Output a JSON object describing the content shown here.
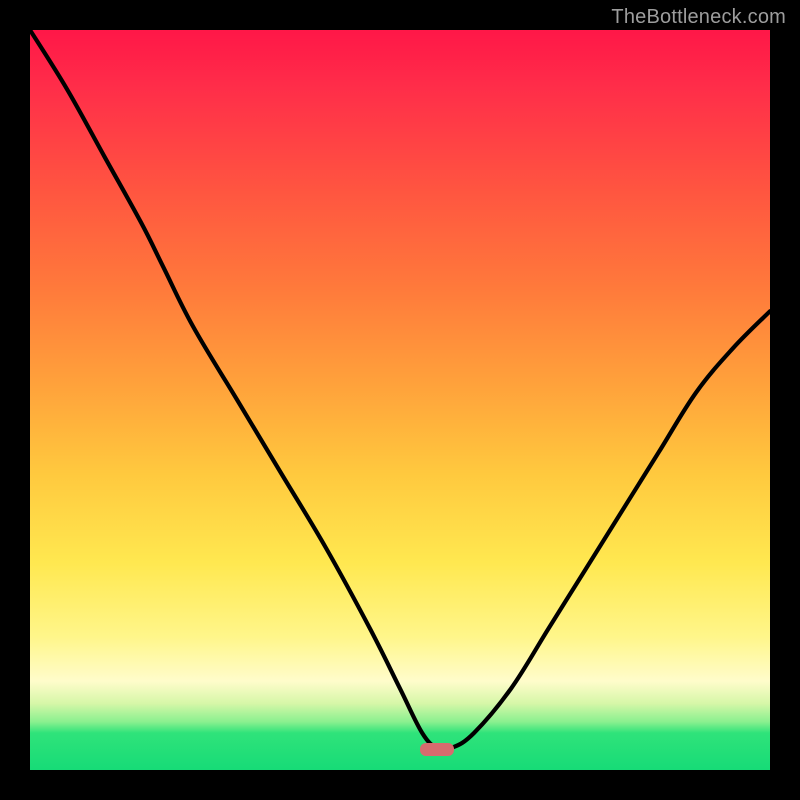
{
  "watermark": "TheBottleneck.com",
  "marker": {
    "x_pct": 55,
    "y_pct": 97.2
  },
  "colors": {
    "curve": "#000000",
    "marker": "#d76b6e",
    "frame": "#000000"
  },
  "chart_data": {
    "type": "line",
    "title": "",
    "xlabel": "",
    "ylabel": "",
    "xlim": [
      0,
      100
    ],
    "ylim": [
      0,
      100
    ],
    "grid": false,
    "legend": false,
    "annotations": [
      "TheBottleneck.com"
    ],
    "series": [
      {
        "name": "bottleneck-curve",
        "description": "V-shaped bottleneck curve; minimum near x≈55 at y≈3; left branch steeper with a gentle knee around x≈18.",
        "x": [
          0,
          5,
          10,
          15,
          18,
          22,
          28,
          34,
          40,
          46,
          50,
          53,
          55,
          57,
          60,
          65,
          70,
          75,
          80,
          85,
          90,
          95,
          100
        ],
        "values": [
          100,
          92,
          83,
          74,
          68,
          60,
          50,
          40,
          30,
          19,
          11,
          5,
          3,
          3,
          5,
          11,
          19,
          27,
          35,
          43,
          51,
          57,
          62
        ]
      }
    ]
  }
}
